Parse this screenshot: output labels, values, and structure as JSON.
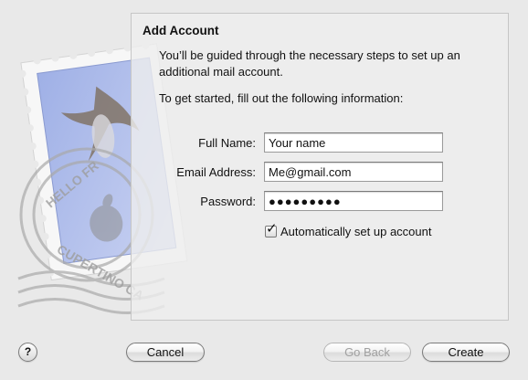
{
  "dialog": {
    "title": "Add Account",
    "intro": "You’ll be guided through the necessary steps to set up an additional mail account.",
    "prompt": "To get started, fill out the following information:"
  },
  "form": {
    "full_name": {
      "label": "Full Name:",
      "value": "Your name"
    },
    "email": {
      "label": "Email Address:",
      "value": "Me@gmail.com"
    },
    "password": {
      "label": "Password:",
      "value": "●●●●●●●●●"
    },
    "auto_setup": {
      "label": "Automatically set up account",
      "checked": true,
      "mark": "✓"
    }
  },
  "stamp": {
    "text_top": "HELLO FR",
    "text_bottom": "CUPERTINO CA"
  },
  "buttons": {
    "help": "?",
    "cancel": "Cancel",
    "go_back": "Go Back",
    "create": "Create"
  }
}
